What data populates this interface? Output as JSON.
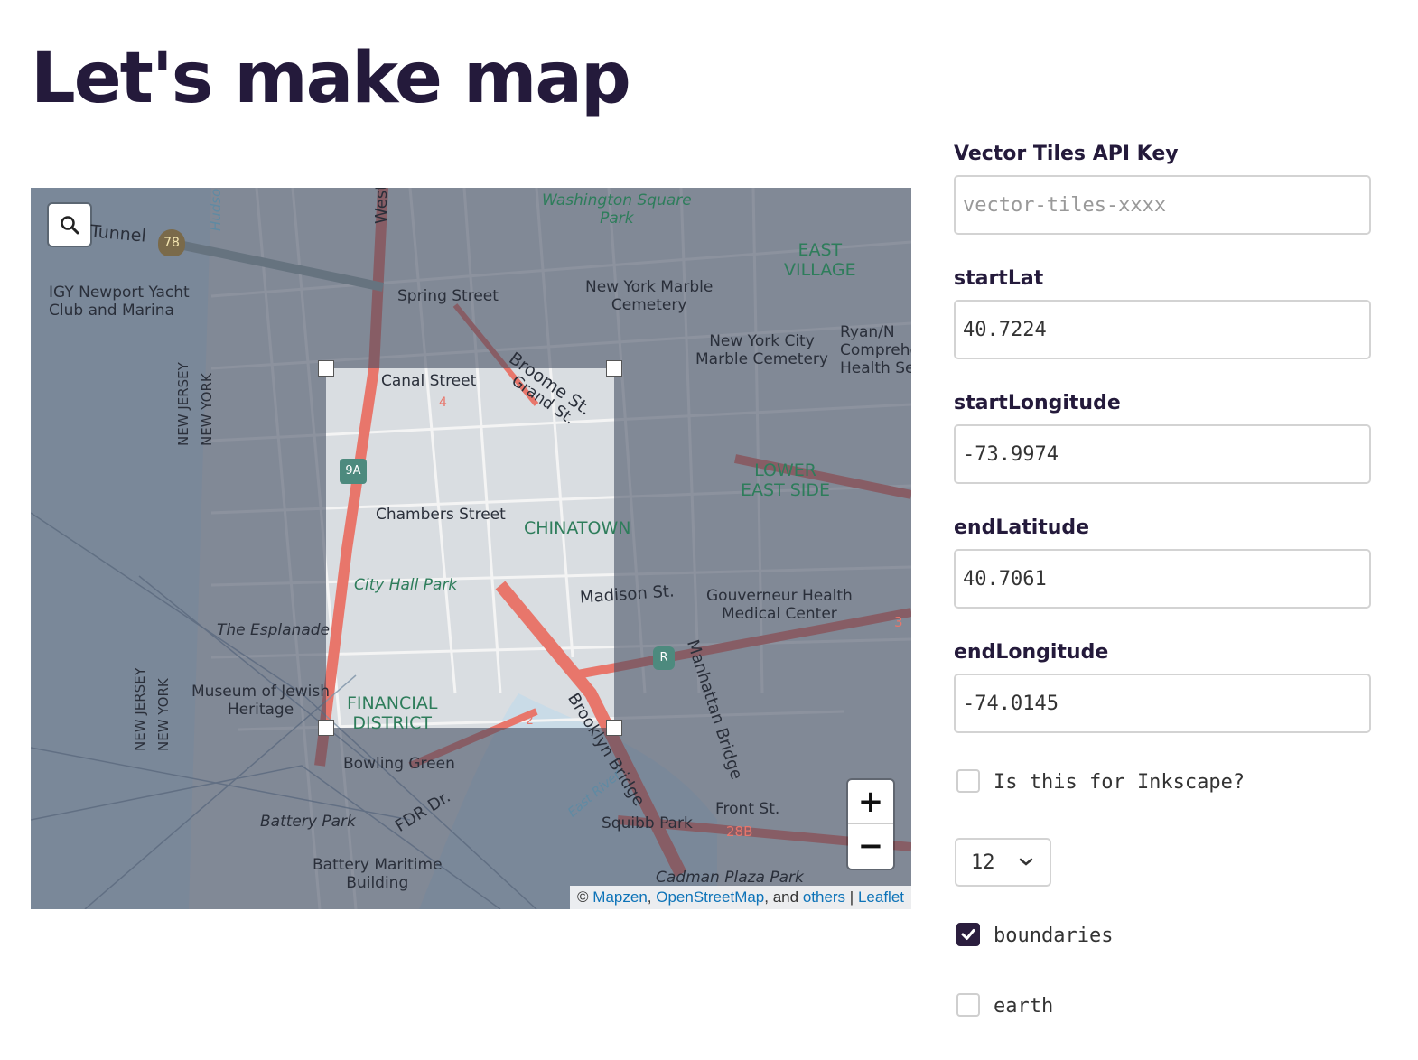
{
  "page": {
    "title": "Let's make map"
  },
  "map": {
    "labels": {
      "tunnel": "Tunnel",
      "highway": "78",
      "west_st": "West St.",
      "hudson": "Hudson",
      "washington_square": "Washington Square\nPark",
      "east_village": "EAST\nVILLAGE",
      "igy": "IGY Newport Yacht\nClub and Marina",
      "spring_street": "Spring Street",
      "ny_marble": "New York Marble\nCemetery",
      "nyc_marble": "New York City\nMarble Cemetery",
      "ryan": "Ryan/N\nComprehe\nHealth Se",
      "broome": "Broome St.",
      "grand": "Grand St.",
      "canal_street": "Canal Street",
      "new_jersey_1": "NEW JERSEY",
      "new_york_1": "NEW YORK",
      "route_9a": "9A",
      "lower_east_side": "LOWER\nEAST SIDE",
      "chambers": "Chambers Street",
      "chinatown": "CHINATOWN",
      "city_hall": "City Hall Park",
      "madison": "Madison St.",
      "gouverneur": "Gouverneur Health\nMedical Center",
      "esplanade": "The Esplanade",
      "museum": "Museum of Jewish\nHeritage",
      "financial": "FINANCIAL\nDISTRICT",
      "brooklyn_bridge": "Brooklyn Bridge",
      "manhattan_bridge": "Manhattan Bridge",
      "new_jersey_2": "NEW JERSEY",
      "new_york_2": "NEW YORK",
      "bowling_green": "Bowling Green",
      "battery_park": "Battery Park",
      "fdr": "FDR Dr.",
      "east_river": "East River",
      "squibb": "Squibb Park",
      "front_st": "Front St.",
      "exit_28b": "28B",
      "battery_maritime": "Battery Maritime\nBuilding",
      "cadman": "Cadman Plaza Park",
      "route_r": "R",
      "exit_3": "3",
      "route_4": "4",
      "route_2": "2"
    },
    "zoom_in": "+",
    "zoom_out": "−",
    "attribution": {
      "prefix": "©",
      "mapzen": "Mapzen",
      "sep1": ",",
      "osm": "OpenStreetMap",
      "and": ", and",
      "others": "others",
      "pipe": "|",
      "leaflet": "Leaflet"
    }
  },
  "form": {
    "api_key_label": "Vector Tiles API Key",
    "api_key_placeholder": "vector-tiles-xxxx",
    "api_key_value": "",
    "start_lat_label": "startLat",
    "start_lat_value": "40.7224",
    "start_lon_label": "startLongitude",
    "start_lon_value": "-73.9974",
    "end_lat_label": "endLatitude",
    "end_lat_value": "40.7061",
    "end_lon_label": "endLongitude",
    "end_lon_value": "-74.0145",
    "inkscape_label": "Is this for Inkscape?",
    "inkscape_checked": false,
    "zoom_select_value": "12",
    "boundaries_label": "boundaries",
    "boundaries_checked": true,
    "earth_label": "earth",
    "earth_checked": false
  },
  "colors": {
    "accent": "#2b1e3e",
    "road": "#e8766b",
    "park_text": "#2e7d5b",
    "link": "#0d73b8",
    "water": "#bcd6e6"
  }
}
